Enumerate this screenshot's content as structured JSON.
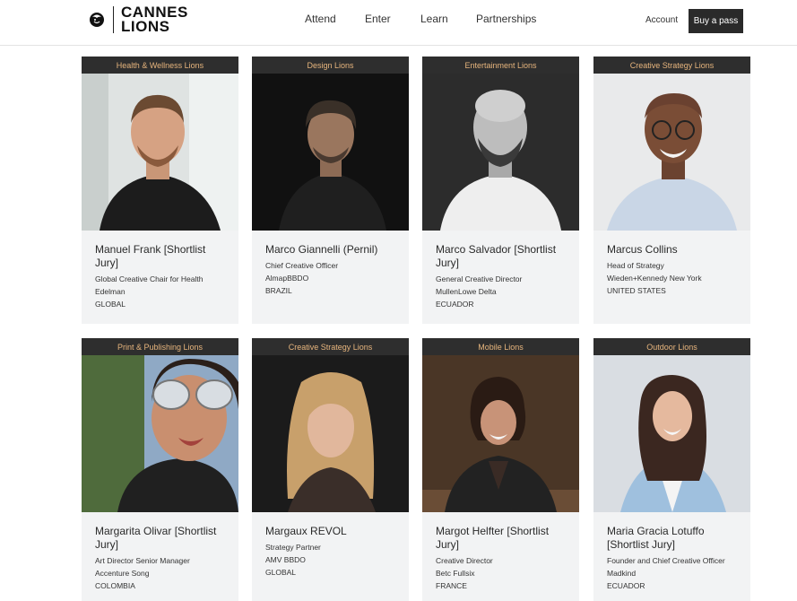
{
  "header": {
    "logo_line1": "CANNES",
    "logo_line2": "LIONS",
    "nav": [
      "Attend",
      "Enter",
      "Learn",
      "Partnerships"
    ],
    "account": "Account",
    "buy": "Buy a pass"
  },
  "cards": [
    {
      "category": "Health & Wellness Lions",
      "name": "Manuel Frank [Shortlist Jury]",
      "lines": [
        "Global Creative Chair for Health",
        "Edelman",
        "GLOBAL"
      ]
    },
    {
      "category": "Design Lions",
      "name": "Marco Giannelli (Pernil)",
      "lines": [
        "Chief Creative Officer",
        "AlmapBBDO",
        "BRAZIL"
      ]
    },
    {
      "category": "Entertainment Lions",
      "name": "Marco Salvador [Shortlist Jury]",
      "lines": [
        "General Creative Director",
        "MullenLowe Delta",
        "ECUADOR"
      ]
    },
    {
      "category": "Creative Strategy Lions",
      "name": "Marcus Collins",
      "lines": [
        "Head of Strategy",
        "Wieden+Kennedy New York",
        "UNITED STATES"
      ]
    },
    {
      "category": "Print & Publishing Lions",
      "name": "Margarita Olivar [Shortlist Jury]",
      "lines": [
        "Art Director Senior Manager",
        "Accenture Song",
        "COLOMBIA"
      ]
    },
    {
      "category": "Creative Strategy Lions",
      "name": "Margaux REVOL",
      "lines": [
        "Strategy Partner",
        "AMV BBDO",
        "GLOBAL"
      ]
    },
    {
      "category": "Mobile Lions",
      "name": "Margot Helfter [Shortlist Jury]",
      "lines": [
        "Creative Director",
        "Betc Fullsix",
        "FRANCE"
      ]
    },
    {
      "category": "Outdoor Lions",
      "name": "Maria Gracia Lotuffo [Shortlist Jury]",
      "lines": [
        "Founder and Chief Creative Officer",
        "Madkind",
        "ECUADOR"
      ]
    }
  ]
}
